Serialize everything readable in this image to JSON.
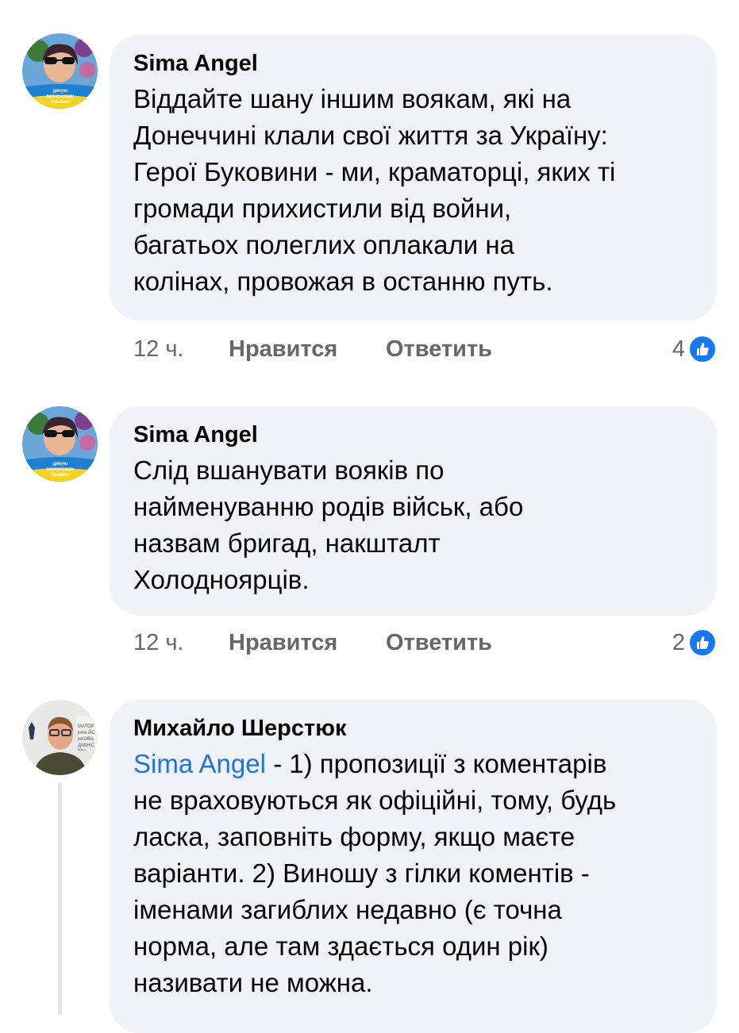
{
  "comments": [
    {
      "author": "Sima Angel",
      "text": "Віддайте шану іншим воякам, які на\nДонеччині клали свої життя за Україну:\nГерої Буковини - ми, краматорці, яких ті\nгромади прихистили від войни,\nбагатьох полеглих оплакали на\nколінах, провожая в останню путь.",
      "time": "12 ч.",
      "like_label": "Нравится",
      "reply_label": "Ответить",
      "reaction_count": "4",
      "avatar_caption": "дякую захисникам України!"
    },
    {
      "author": "Sima Angel",
      "text": "Слід вшанувати вояків по\nнайменуванню родів військ, або\nназвам бригад, накшталт\nХолодноярців.",
      "time": "12 ч.",
      "like_label": "Нравится",
      "reply_label": "Ответить",
      "reaction_count": "2",
      "avatar_caption": "дякую захисникам України!"
    },
    {
      "author": "Михайло Шерстюк",
      "mention": "Sima Angel",
      "text": " - 1) пропозиції з коментарів\nне враховуються як офіційні, тому, будь\nласка, заповніть форму, якщо маєте\nваріанти. 2) Виношу з гілки коментів -\nіменами загиблих недавно (є точна\nнорма, але там здається один рік)\nназивати не можна.",
      "avatar_caption": "МАТОР ЬКА ЙСЬКОВА ДМІНІСТРА"
    }
  ],
  "colors": {
    "bubble": "#f0f2f5",
    "meta_text": "#65676b",
    "mention": "#1b74e4",
    "like_badge": "#1877f2"
  },
  "icons": [
    "thumbs-up-icon",
    "trident-icon"
  ]
}
